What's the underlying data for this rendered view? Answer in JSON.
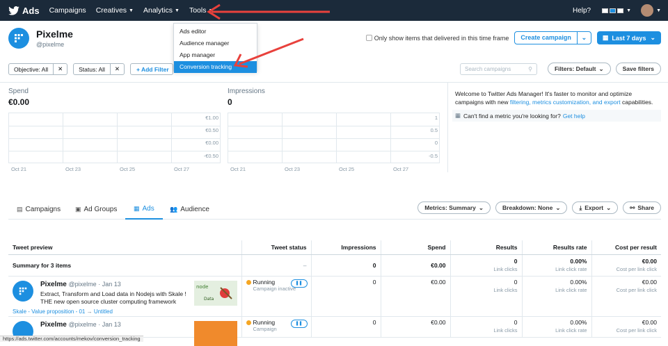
{
  "nav": {
    "brand": "Ads",
    "items": [
      "Campaigns",
      "Creatives",
      "Analytics",
      "Tools"
    ],
    "help": "Help?"
  },
  "tools_menu": {
    "items": [
      "Ads editor",
      "Audience manager",
      "App manager",
      "Conversion tracking"
    ],
    "active_index": 3
  },
  "account": {
    "name": "Pixelme",
    "handle": "@pixelme"
  },
  "header_actions": {
    "checkbox_label": "Only show items that delivered in this time frame",
    "create_campaign": "Create campaign",
    "date_range": "Last 7 days"
  },
  "filters": {
    "objective": "Objective: All",
    "status": "Status: All",
    "add_filter": "+ Add Filter",
    "search_placeholder": "Search campaigns",
    "filters_default": "Filters: Default",
    "save_filters": "Save filters"
  },
  "spend": {
    "label": "Spend",
    "value": "€0.00",
    "y_ticks": [
      "€1.00",
      "€0.50",
      "€0.00",
      "-€0.50"
    ],
    "x_ticks": [
      "Oct 21",
      "Oct 23",
      "Oct 25",
      "Oct 27"
    ]
  },
  "impressions": {
    "label": "Impressions",
    "value": "0",
    "y_ticks": [
      "1",
      "0.5",
      "0",
      "-0.5"
    ],
    "x_ticks": [
      "Oct 21",
      "Oct 23",
      "Oct 25",
      "Oct 27"
    ]
  },
  "welcome": {
    "text": "Welcome to Twitter Ads Manager! It's faster to monitor and optimize campaigns with new ",
    "link": "filtering, metrics customization, and export",
    "tail": " capabilities.",
    "tip": "Can't find a metric you're looking for?",
    "tip_link": "Get help"
  },
  "tabs": [
    "Campaigns",
    "Ad Groups",
    "Ads",
    "Audience"
  ],
  "table_actions": {
    "metrics": "Metrics: Summary",
    "breakdown": "Breakdown: None",
    "export": "Export",
    "share": "Share"
  },
  "table": {
    "headers": [
      "Tweet preview",
      "Tweet status",
      "Impressions",
      "Spend",
      "Results",
      "Results rate",
      "Cost per result"
    ],
    "summary": {
      "label": "Summary for 3 items",
      "status": "–",
      "impressions": "0",
      "spend": "€0.00",
      "results": "0",
      "results_sub": "Link clicks",
      "rate": "0.00%",
      "rate_sub": "Link click rate",
      "cost": "€0.00",
      "cost_sub": "Cost per link click"
    },
    "rows": [
      {
        "name": "Pixelme",
        "handle": "@pixelme",
        "date": "· Jan 13",
        "text": "Extract, Transform and Load data in Nodejs with Skale ! THE new open source cluster computing framework",
        "campaign": "Skale - Value proposition - 01",
        "ad_group": "Untitled",
        "status": "Running",
        "status_sub": "Campaign inactive",
        "impressions": "0",
        "spend": "€0.00",
        "results": "0",
        "results_sub": "Link clicks",
        "rate": "0.00%",
        "rate_sub": "Link click rate",
        "cost": "€0.00",
        "cost_sub": "Cost per link click"
      },
      {
        "name": "Pixelme",
        "handle": "@pixelme",
        "date": "· Jan 13",
        "status": "Running",
        "status_sub": "Campaign",
        "impressions": "0",
        "spend": "€0.00",
        "results": "0",
        "results_sub": "Link clicks",
        "rate": "0.00%",
        "rate_sub": "Link click rate",
        "cost": "€0.00",
        "cost_sub": "Cost per link click"
      }
    ]
  },
  "statusbar": "https://ads.twitter.com/accounts/mekov/conversion_tracking",
  "colors": {
    "nav_bg": "#1b2a3a",
    "accent": "#1d8fe0",
    "annotation_arrow": "#e8413c",
    "running_dot": "#f5a623"
  }
}
